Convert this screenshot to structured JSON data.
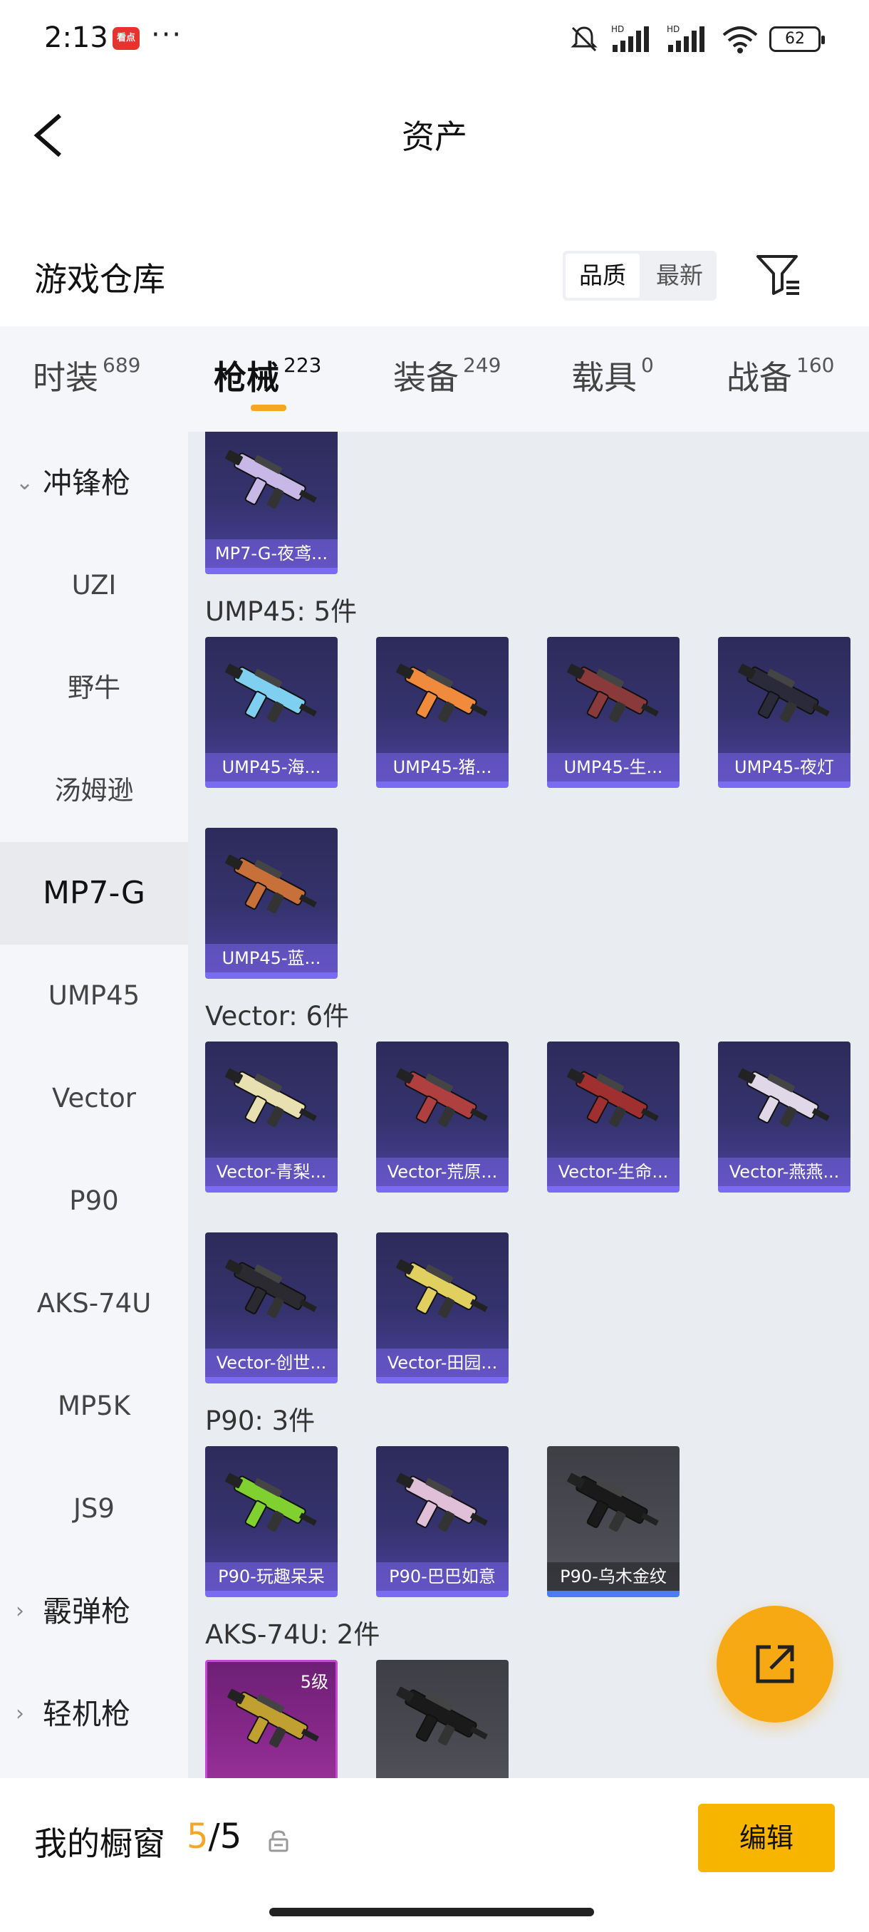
{
  "status_bar": {
    "time": "2:13",
    "app_badge": "看点",
    "more": "···",
    "battery": "62"
  },
  "header": {
    "title": "资产",
    "warehouse_title": "游戏仓库",
    "sort_options": [
      "品质",
      "最新"
    ],
    "sort_selected": "品质"
  },
  "tabs": [
    {
      "label": "时装",
      "count": "689"
    },
    {
      "label": "枪械",
      "count": "223",
      "active": true
    },
    {
      "label": "装备",
      "count": "249"
    },
    {
      "label": "载具",
      "count": "0"
    },
    {
      "label": "战备",
      "count": "160"
    }
  ],
  "sidebar": {
    "items": [
      {
        "label": "冲锋枪",
        "type": "category",
        "expanded": true
      },
      {
        "label": "UZI"
      },
      {
        "label": "野牛"
      },
      {
        "label": "汤姆逊"
      },
      {
        "label": "MP7-G",
        "active": true
      },
      {
        "label": "UMP45"
      },
      {
        "label": "Vector"
      },
      {
        "label": "P90"
      },
      {
        "label": "AKS-74U"
      },
      {
        "label": "MP5K"
      },
      {
        "label": "JS9"
      },
      {
        "label": "霰弹枪",
        "type": "category"
      },
      {
        "label": "轻机枪",
        "type": "category"
      }
    ]
  },
  "content": {
    "mp7_cards": [
      {
        "name": "MP7-G-夜鸢...",
        "color": "#c8b8e8"
      }
    ],
    "groups": [
      {
        "label": "UMP45: 5件",
        "cards": [
          {
            "name": "UMP45-海...",
            "color": "#7fd0f0"
          },
          {
            "name": "UMP45-猪...",
            "color": "#f08a3c"
          },
          {
            "name": "UMP45-生...",
            "color": "#8a3a3a"
          },
          {
            "name": "UMP45-夜灯",
            "color": "#2a2a3a"
          },
          {
            "name": "UMP45-蓝...",
            "color": "#c8703a"
          }
        ]
      },
      {
        "label": "Vector: 6件",
        "cards": [
          {
            "name": "Vector-青梨...",
            "color": "#e8e0b0"
          },
          {
            "name": "Vector-荒原...",
            "color": "#b04040"
          },
          {
            "name": "Vector-生命...",
            "color": "#a03030"
          },
          {
            "name": "Vector-燕燕...",
            "color": "#e0d8e8"
          },
          {
            "name": "Vector-创世...",
            "color": "#2a2a30"
          },
          {
            "name": "Vector-田园...",
            "color": "#e0d060"
          }
        ]
      },
      {
        "label": "P90: 3件",
        "cards": [
          {
            "name": "P90-玩趣呆呆",
            "color": "#80d030"
          },
          {
            "name": "P90-巴巴如意",
            "color": "#e0c0d8"
          },
          {
            "name": "P90-乌木金纹",
            "color": "#1a1a1a",
            "grey": true
          }
        ]
      },
      {
        "label": "AKS-74U: 2件",
        "cards": [
          {
            "name": "",
            "color": "#c0a030",
            "purple": true,
            "level": "5级"
          },
          {
            "name": "",
            "color": "#1a1a1a",
            "grey": true
          }
        ]
      }
    ]
  },
  "bottom_bar": {
    "label": "我的橱窗",
    "count_current": "5",
    "count_sep_total": "/5",
    "edit": "编辑"
  },
  "colors": {
    "accent": "#f5a623",
    "edit_button": "#f7b500",
    "fab": "#f6a913"
  }
}
